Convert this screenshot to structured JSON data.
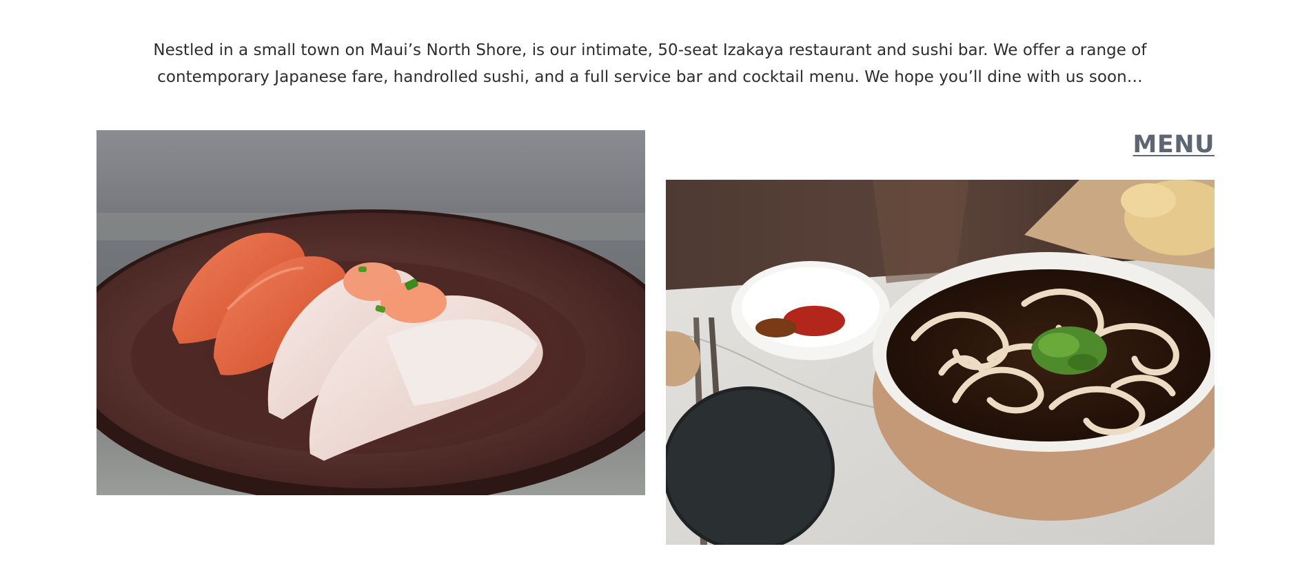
{
  "intro": {
    "text": "Nestled in a small town on Maui’s North Shore, is our intimate, 50-seat Izakaya restaurant and sushi bar. We offer a range of contemporary Japanese fare, handrolled sushi, and a full service bar and cocktail menu. We hope you’ll dine with us soon…"
  },
  "menu": {
    "label": "MENU"
  },
  "photos": {
    "left": "sushi-nigiri-plate",
    "right": "udon-noodle-bowl"
  },
  "colors": {
    "text": "#2d2d2d",
    "menu_link": "#5d6672",
    "background": "#ffffff"
  }
}
